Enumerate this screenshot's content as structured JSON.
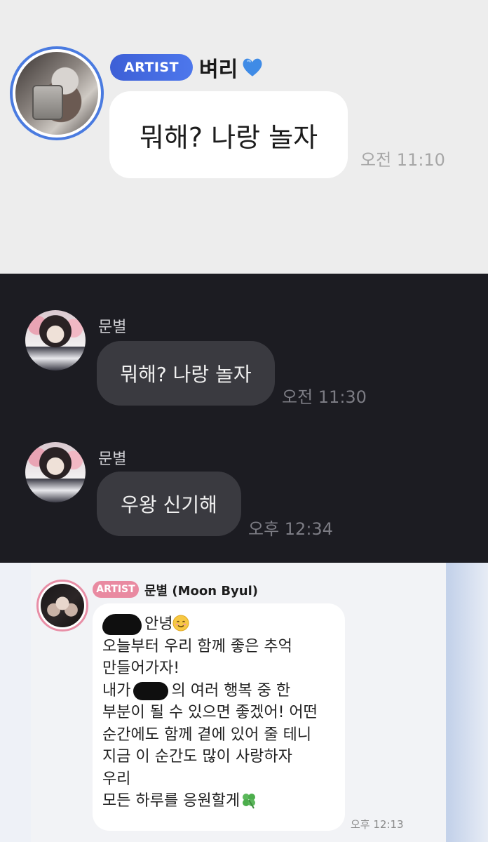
{
  "section1": {
    "badge": "ARTIST",
    "name": "벼리",
    "name_emoji": "blue-heart-icon",
    "message": "뭐해? 나랑 놀자",
    "time": "오전 11:10",
    "accent_color": "#4a7be0"
  },
  "section2": {
    "messages": [
      {
        "sender": "문별",
        "text": "뭐해? 나랑 놀자",
        "time": "오전 11:30"
      },
      {
        "sender": "문별",
        "text": "우왕 신기해",
        "time": "오후 12:34"
      }
    ],
    "background_color": "#1c1c22",
    "bubble_color": "#3a3a40"
  },
  "section3": {
    "badge": "ARTIST",
    "name": "문별 (Moon Byul)",
    "lines": {
      "l1_after": "안녕",
      "l2": "오늘부터 우리 함께 좋은 추억",
      "l3": "만들어가자!",
      "l4_before": "내가",
      "l4_after": "의 여러 행복 중 한",
      "l5": "부분이 될 수 있으면 좋겠어! 어떤",
      "l6": "순간에도 함께 곁에 있어 줄 테니",
      "l7": "지금 이 순간도 많이 사랑하자",
      "l8": "우리",
      "l9": "모든 하루를 응원할게"
    },
    "time": "오후 12:13",
    "accent_color": "#e98aa1"
  }
}
